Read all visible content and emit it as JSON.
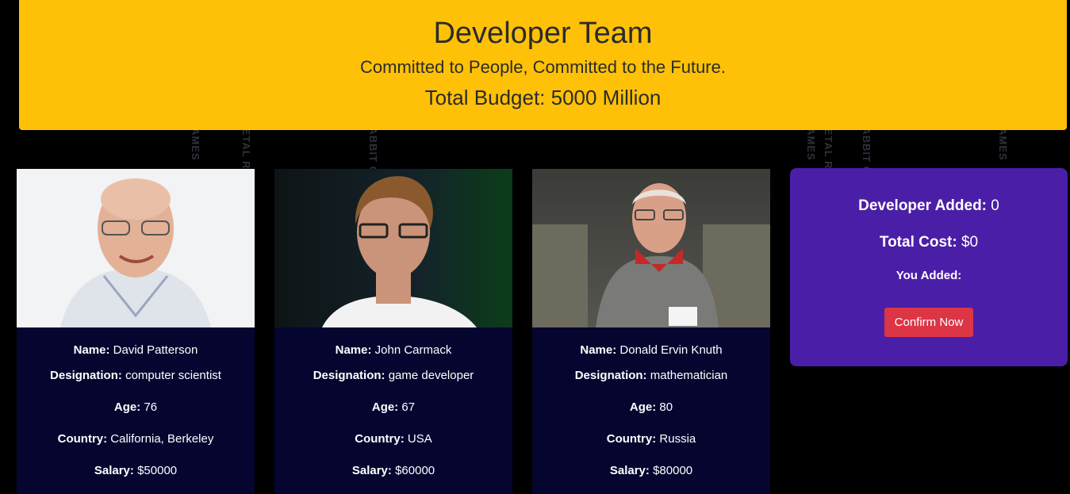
{
  "header": {
    "title": "Developer Team",
    "tagline": "Committed to People, Committed to the Future.",
    "budget": "Total Budget: 5000 Million"
  },
  "labels": {
    "name": "Name:",
    "designation": "Designation:",
    "age": "Age:",
    "country": "Country:",
    "salary": "Salary:"
  },
  "developers": [
    {
      "name": "David Patterson",
      "designation": "computer scientist",
      "age": "76",
      "country": "California, Berkeley",
      "salary": "$50000"
    },
    {
      "name": "John Carmack",
      "designation": "game developer",
      "age": "67",
      "country": "USA",
      "salary": "$60000"
    },
    {
      "name": "Donald Ervin Knuth",
      "designation": "mathematician",
      "age": "80",
      "country": "Russia",
      "salary": "$80000"
    }
  ],
  "summary": {
    "developer_added_label": "Developer Added:",
    "developer_added_value": "0",
    "total_cost_label": "Total Cost:",
    "total_cost_value": "$0",
    "you_added_label": "You Added:",
    "confirm_label": "Confirm Now"
  },
  "background_text": [
    "GAMES",
    "METAL RABBIT GAMES",
    "RABBIT GAMES",
    "GAMES",
    "METAL RABBIT",
    "RABBIT GAMES",
    "GAMES"
  ],
  "colors": {
    "header_bg": "#ffc107",
    "card_bg": "#050530",
    "summary_bg": "#4b1ea7",
    "confirm_bg": "#dc3545"
  }
}
